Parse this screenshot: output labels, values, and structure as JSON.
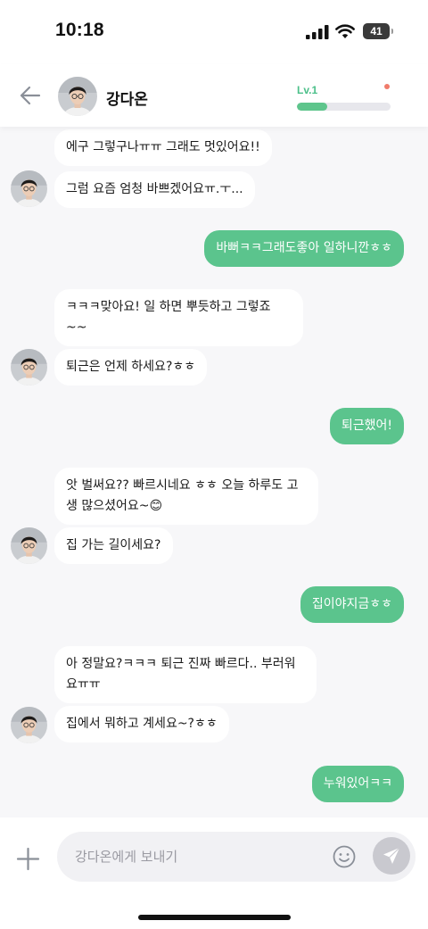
{
  "status_bar": {
    "time": "10:18",
    "battery": "41"
  },
  "header": {
    "name": "강다온",
    "level": "Lv.1",
    "level_progress": 0.32,
    "back_icon": "arrow-left-icon"
  },
  "messages": [
    {
      "side": "in",
      "text": "에구 그렇구나ㅠㅠ 그래도 멋있어요!!"
    },
    {
      "side": "in",
      "text": "그럼 요즘 엄청 바쁘겠어요ㅠ.ㅜ..."
    },
    {
      "side": "out",
      "text": "바뻐ㅋㅋ그래도좋아 일하니깐ㅎㅎ"
    },
    {
      "side": "in",
      "text": "ㅋㅋㅋ맞아요! 일 하면 뿌듯하고 그렇죠 ~~"
    },
    {
      "side": "in",
      "text": "퇴근은 언제 하세요?ㅎㅎ"
    },
    {
      "side": "out",
      "text": "퇴근했어!"
    },
    {
      "side": "in",
      "text": "앗 벌써요?? 빠르시네요 ㅎㅎ 오늘 하루도 고생 많으셨어요~😊"
    },
    {
      "side": "in",
      "text": "집 가는 길이세요?"
    },
    {
      "side": "out",
      "text": "집이야지금ㅎㅎ"
    },
    {
      "side": "in",
      "text": "아 정말요?ㅋㅋㅋ 퇴근 진짜 빠르다.. 부러워요ㅠㅠ"
    },
    {
      "side": "in",
      "text": "집에서 뭐하고 계세요~?ㅎㅎ"
    },
    {
      "side": "out",
      "text": "누워있어ㅋㅋ"
    }
  ],
  "input": {
    "placeholder": "강다온에게 보내기"
  },
  "colors": {
    "accent": "#5bc48d",
    "level": "#4cc08a",
    "notice_dot": "#f07b6b"
  }
}
